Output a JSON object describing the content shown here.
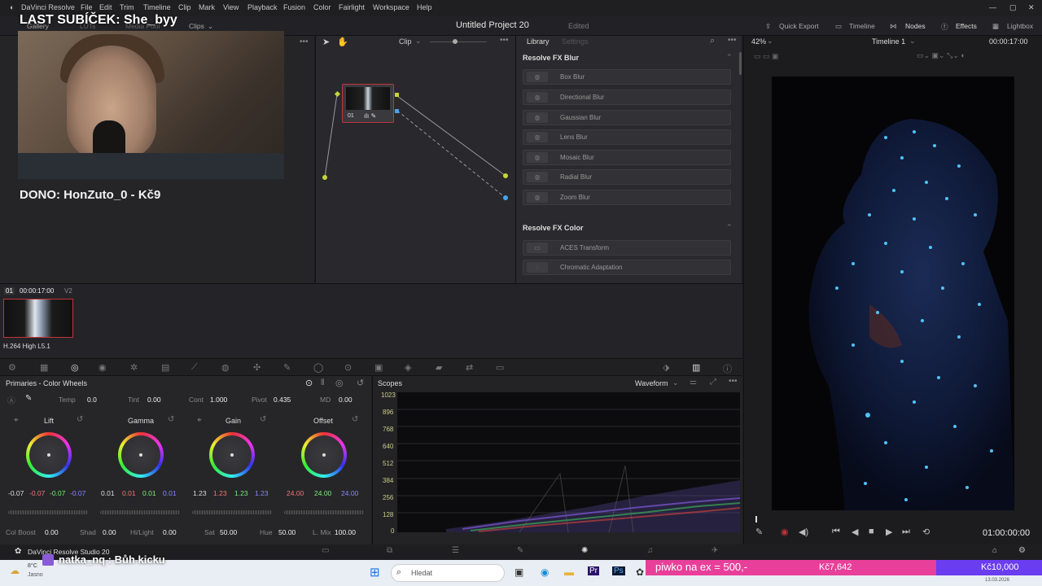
{
  "menu": {
    "app": "DaVinci Resolve",
    "items": [
      "File",
      "Edit",
      "Trim",
      "Timeline",
      "Clip",
      "Mark",
      "View",
      "Playback",
      "Fusion",
      "Color",
      "Fairlight",
      "Workspace",
      "Help"
    ]
  },
  "tabs": {
    "gallery": "Gallery",
    "luts": "LUTs",
    "media_pool": "Media Pool",
    "clips": "Clips",
    "quick_export": "Quick Export",
    "timeline": "Timeline",
    "nodes": "Nodes",
    "effects": "Effects",
    "lightbox": "Lightbox"
  },
  "project": {
    "title": "Untitled Project 20",
    "status": "Edited"
  },
  "overlay": {
    "last_sub": "LAST SUBÍČEK: She_byy",
    "dono": "DONO: HonZuto_0 - Kč9"
  },
  "node_editor": {
    "mode": "Clip",
    "node_label": "01"
  },
  "library": {
    "tab_library": "Library",
    "tab_settings": "Settings",
    "section_blur": "Resolve FX Blur",
    "blur_items": [
      "Box Blur",
      "Directional Blur",
      "Gaussian Blur",
      "Lens Blur",
      "Mosaic Blur",
      "Radial Blur",
      "Zoom Blur"
    ],
    "section_color": "Resolve FX Color",
    "color_items": [
      "ACES Transform",
      "Chromatic Adaptation"
    ]
  },
  "viewer": {
    "zoom": "42%",
    "timeline_name": "Timeline 1",
    "timecode": "00:00:17:00",
    "playhead": "01:00:00:00"
  },
  "clip": {
    "number": "01",
    "timecode": "00:00:17:00",
    "track": "V2",
    "codec": "H.264 High L5.1"
  },
  "primaries": {
    "title": "Primaries - Color Wheels",
    "temp_label": "Temp",
    "temp": "0.0",
    "tint_label": "Tint",
    "tint": "0.00",
    "cont_label": "Cont",
    "cont": "1.000",
    "pivot_label": "Pivot",
    "pivot": "0.435",
    "md_label": "MD",
    "md": "0.00",
    "wheels": [
      {
        "name": "Lift",
        "values": [
          "-0.07",
          "-0.07",
          "-0.07",
          "-0.07"
        ]
      },
      {
        "name": "Gamma",
        "values": [
          "0.01",
          "0.01",
          "0.01",
          "0.01"
        ]
      },
      {
        "name": "Gain",
        "values": [
          "1.23",
          "1.23",
          "1.23",
          "1.23"
        ]
      },
      {
        "name": "Offset",
        "values": [
          "24.00",
          "24.00",
          "24.00"
        ]
      }
    ],
    "colboost_label": "Col Boost",
    "colboost": "0.00",
    "shad_label": "Shad",
    "shad": "0.00",
    "hilight_label": "Hi/Light",
    "hilight": "0.00",
    "sat_label": "Sat",
    "sat": "50.00",
    "hue_label": "Hue",
    "hue": "50.00",
    "lmix_label": "L. Mix",
    "lmix": "100.00"
  },
  "scopes": {
    "title": "Scopes",
    "mode": "Waveform",
    "ticks": [
      "1023",
      "896",
      "768",
      "640",
      "512",
      "384",
      "256",
      "128",
      "0"
    ]
  },
  "bottom": {
    "app_name": "DaVinci Resolve Studio 20",
    "chat": "natka_nq : Bůh kicku"
  },
  "taskbar": {
    "search": "Hledat",
    "weather_temp": "8°C",
    "weather_text": "Jasno",
    "date": "13.03.2026"
  },
  "donation": {
    "text": "piwko na ex = 500,-",
    "current": "Kč7,642",
    "goal": "Kč10,000"
  },
  "colors": {
    "accent_red": "#e8409a",
    "accent_purple": "#6b3df0",
    "node_border": "#c0343c"
  }
}
